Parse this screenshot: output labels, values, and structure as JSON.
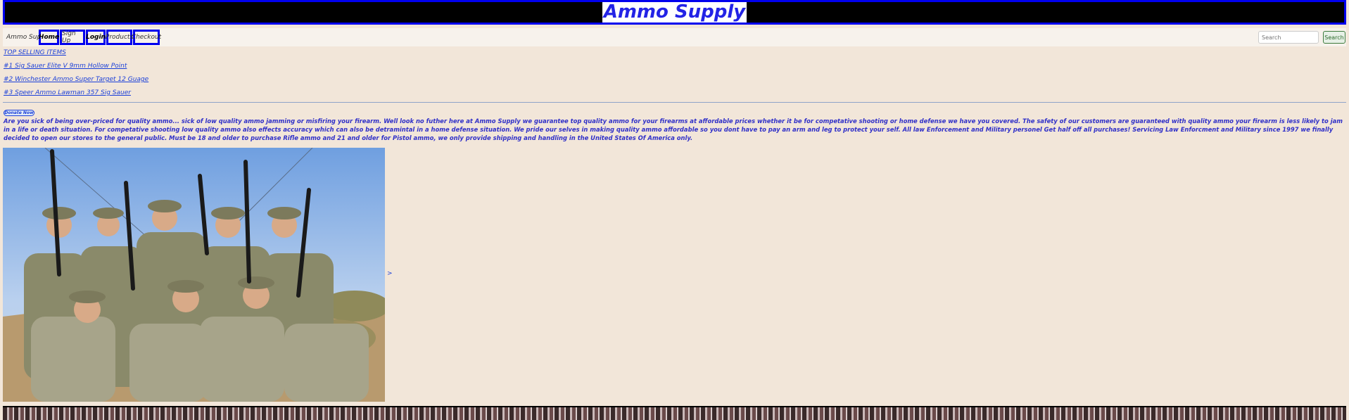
{
  "banner": {
    "title": "Ammo Supply"
  },
  "navbar": {
    "brand": "Ammo Supply",
    "items": [
      {
        "label": "Home"
      },
      {
        "label": "Sign Up"
      },
      {
        "label": "Login"
      },
      {
        "label": "Products"
      },
      {
        "label": "Checkout"
      }
    ],
    "search": {
      "placeholder": "Search",
      "button_label": "Search"
    }
  },
  "top_selling": {
    "heading": "TOP SELLING ITEMS",
    "items": [
      {
        "label": "#1 Sig Sauer Elite V 9mm Hollow Point"
      },
      {
        "label": "#2 Winchester Ammo Super Target 12 Guage"
      },
      {
        "label": "#3 Speer Ammo Lawman 357 Sig Sauer"
      }
    ]
  },
  "donate": {
    "label": "Donate Now"
  },
  "intro": {
    "text": "Are you sick of being over-priced for quality ammo... sick of low quality ammo jamming or misfiring your firearm. Well look no futher here at Ammo Supply we guarantee top quality ammo for your firearms at affordable prices whether it be for competative shooting or home defense we have you covered. The safety of our customers are guaranteed with quality ammo your firearm is less likely to jam in a life or death situation. For competative shooting low quality ammo also effects accuracy which can also be detramintal in a home defense situation. We pride our selves in making quality ammo affordable so you dont have to pay an arm and leg to protect your self. All law Enforcement and Military personel Get half off all purchases! Servicing Law Enforcment and Military since 1997 we finally decided to open our stores to the general public. Must be 18 and older to purchase Rifle ammo and 21 and older for Pistol ammo, we only provide shipping and handling in the United States Of America only."
  },
  "image": {
    "caret": ">"
  },
  "colors": {
    "page_bg": "#f2e6d9",
    "accent_blue": "#0000ee",
    "link_blue": "#1a3fd9",
    "footer_red": "#d40000"
  }
}
